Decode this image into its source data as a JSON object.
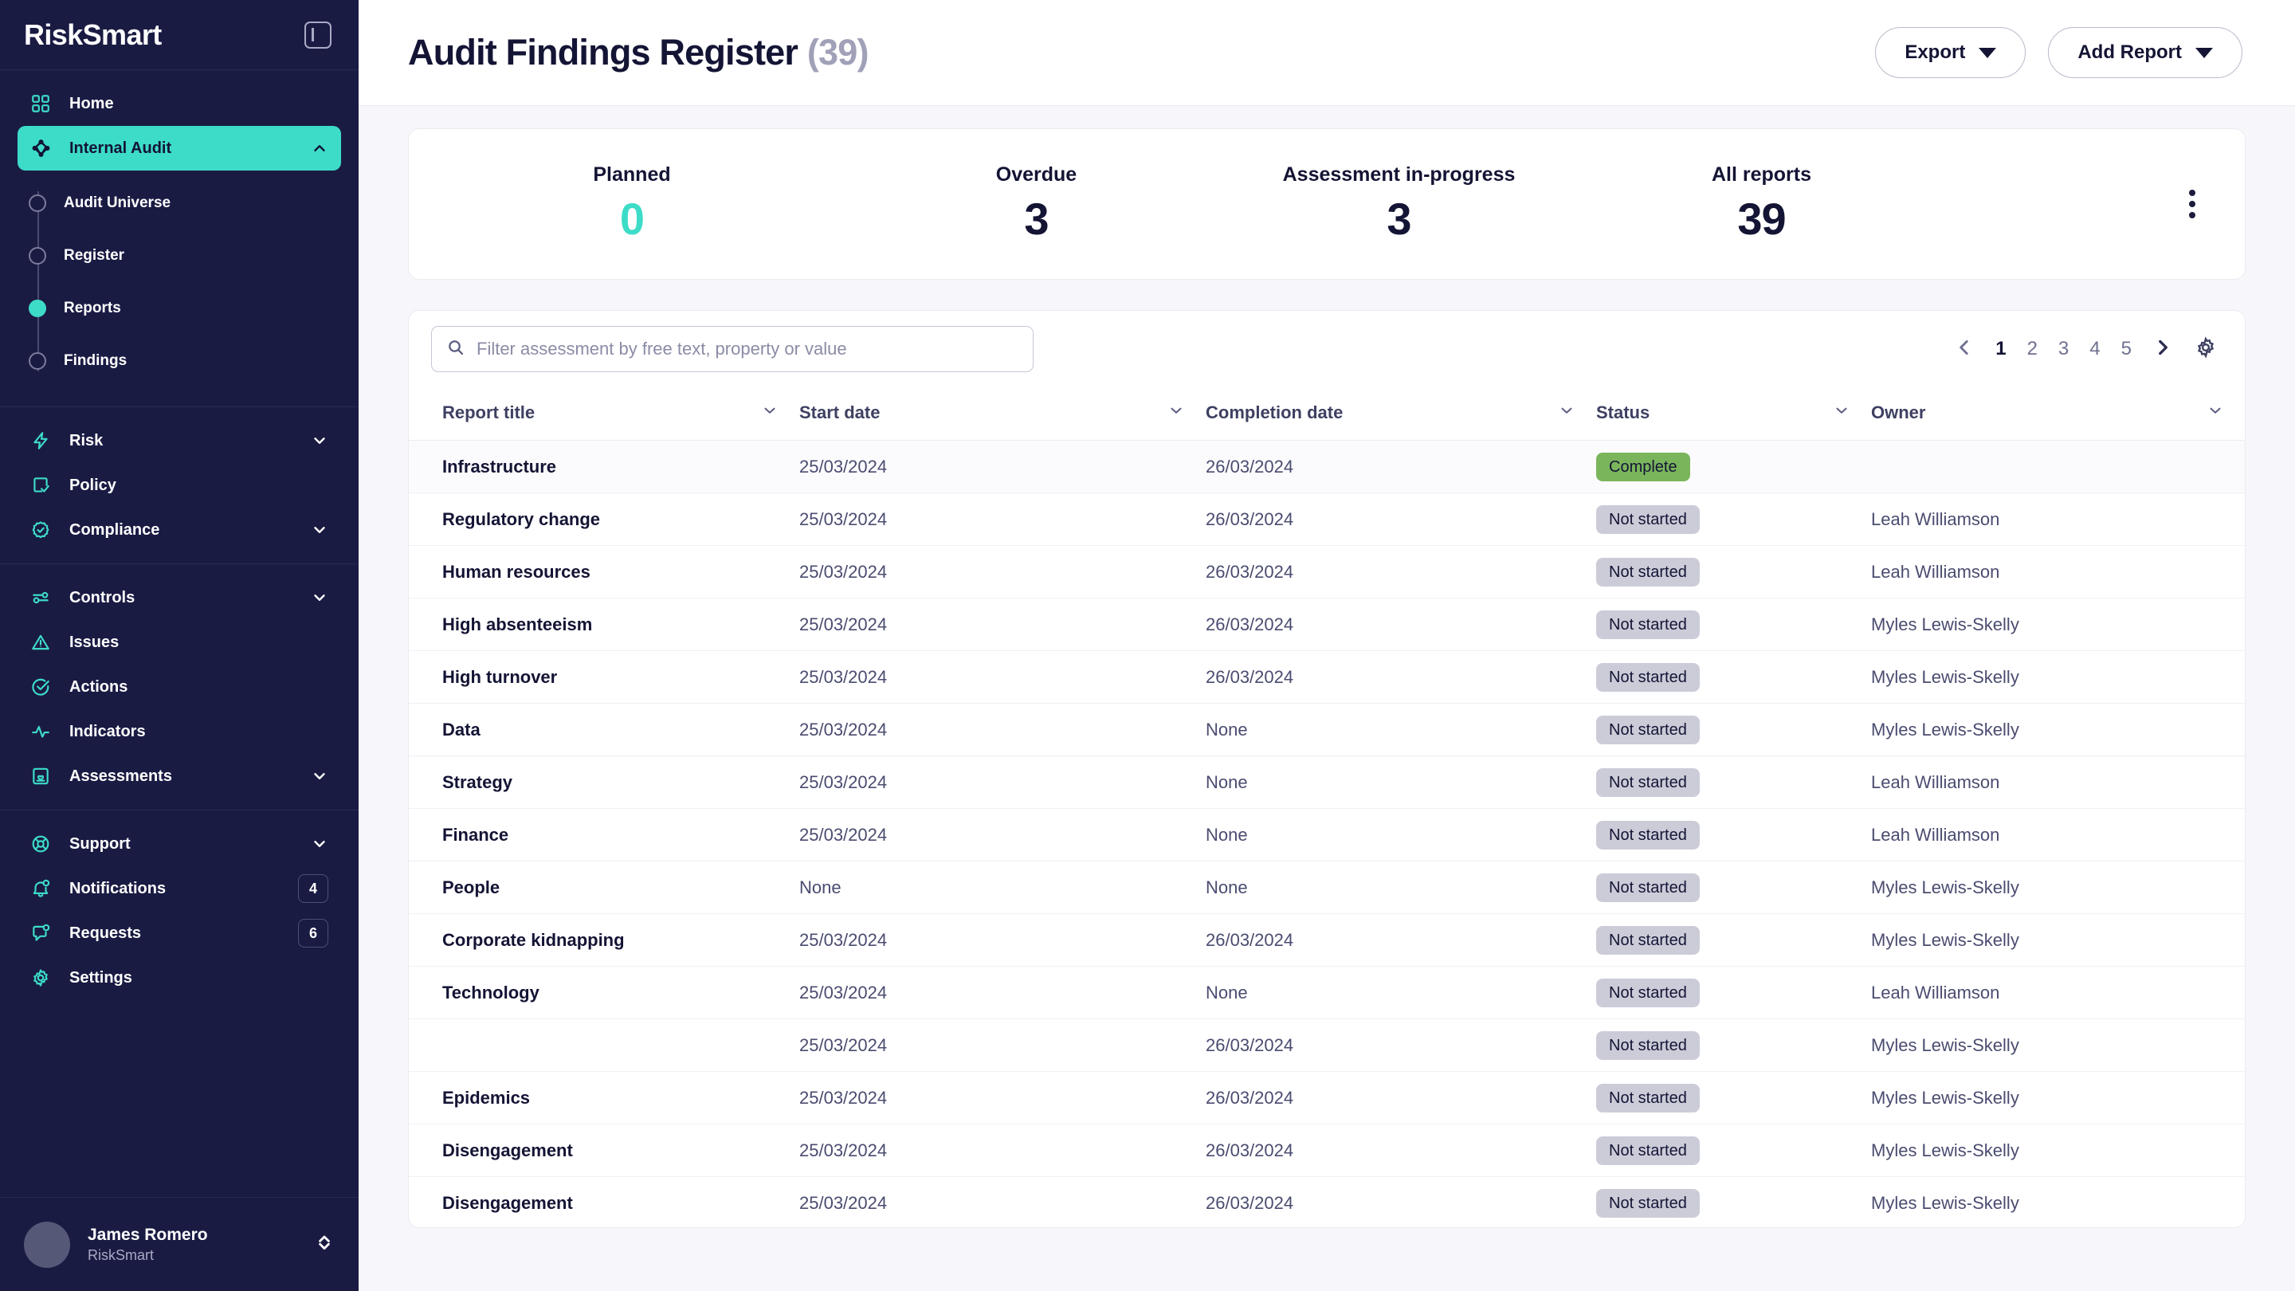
{
  "brand": {
    "name": "RiskSmart",
    "collapse_icon": "panel-collapse-icon"
  },
  "sidebar": {
    "items": [
      {
        "label": "Home",
        "icon": "grid-icon",
        "expandable": false,
        "active": false
      },
      {
        "label": "Internal Audit",
        "icon": "audit-node-icon",
        "expandable": true,
        "expanded": true,
        "active": true
      },
      {
        "label": "Risk",
        "icon": "bolt-icon",
        "expandable": true,
        "active": false
      },
      {
        "label": "Policy",
        "icon": "document-check-icon",
        "expandable": false,
        "active": false
      },
      {
        "label": "Compliance",
        "icon": "badge-check-icon",
        "expandable": true,
        "active": false
      },
      {
        "label": "Controls",
        "icon": "sliders-icon",
        "expandable": true,
        "active": false
      },
      {
        "label": "Issues",
        "icon": "warning-triangle-icon",
        "expandable": false,
        "active": false
      },
      {
        "label": "Actions",
        "icon": "circle-check-icon",
        "expandable": false,
        "active": false
      },
      {
        "label": "Indicators",
        "icon": "pulse-icon",
        "expandable": false,
        "active": false
      },
      {
        "label": "Assessments",
        "icon": "clipboard-heart-icon",
        "expandable": true,
        "active": false
      },
      {
        "label": "Support",
        "icon": "lifebuoy-icon",
        "expandable": true,
        "active": false
      },
      {
        "label": "Notifications",
        "icon": "bell-icon",
        "expandable": false,
        "badge": "4",
        "active": false
      },
      {
        "label": "Requests",
        "icon": "chat-bubble-icon",
        "expandable": false,
        "badge": "6",
        "active": false
      },
      {
        "label": "Settings",
        "icon": "gear-icon",
        "expandable": false,
        "active": false
      }
    ],
    "subitems": [
      {
        "label": "Audit Universe",
        "active": false
      },
      {
        "label": "Register",
        "active": false
      },
      {
        "label": "Reports",
        "active": true
      },
      {
        "label": "Findings",
        "active": false
      }
    ],
    "user": {
      "name": "James Romero",
      "org": "RiskSmart",
      "chevron_icon": "chevron-up-down-icon"
    }
  },
  "header": {
    "title": "Audit Findings Register",
    "count": "(39)",
    "export_label": "Export",
    "add_report_label": "Add Report"
  },
  "stats": {
    "items": [
      {
        "label": "Planned",
        "value": "0",
        "accent": true
      },
      {
        "label": "Overdue",
        "value": "3",
        "accent": false
      },
      {
        "label": "Assessment in-progress",
        "value": "3",
        "accent": false
      },
      {
        "label": "All reports",
        "value": "39",
        "accent": false
      }
    ],
    "menu_icon": "kebab-menu-icon"
  },
  "search": {
    "placeholder": "Filter assessment by free text, property or value",
    "value": "",
    "icon": "search-icon"
  },
  "pagination": {
    "prev_icon": "chevron-left-icon",
    "next_icon": "chevron-right-icon",
    "settings_icon": "gear-icon",
    "pages": [
      "1",
      "2",
      "3",
      "4",
      "5"
    ],
    "current": "1"
  },
  "table": {
    "columns": [
      {
        "label": "Report title",
        "sort_icon": "chevron-down-icon"
      },
      {
        "label": "Start date",
        "sort_icon": "chevron-down-icon"
      },
      {
        "label": "Completion date",
        "sort_icon": "chevron-down-icon"
      },
      {
        "label": "Status",
        "sort_icon": "chevron-down-icon"
      },
      {
        "label": "Owner",
        "sort_icon": "chevron-down-icon"
      }
    ],
    "rows": [
      {
        "title": "Infrastructure",
        "start": "25/03/2024",
        "completion": "26/03/2024",
        "status": "Complete",
        "status_type": "green",
        "owner": "",
        "highlight": true
      },
      {
        "title": "Regulatory change",
        "start": "25/03/2024",
        "completion": "26/03/2024",
        "status": "Not started",
        "status_type": "grey",
        "owner": "Leah Williamson",
        "highlight": false
      },
      {
        "title": "Human resources",
        "start": "25/03/2024",
        "completion": "26/03/2024",
        "status": "Not started",
        "status_type": "grey",
        "owner": "Leah Williamson",
        "highlight": false
      },
      {
        "title": "High absenteeism",
        "start": "25/03/2024",
        "completion": "26/03/2024",
        "status": "Not started",
        "status_type": "grey",
        "owner": "Myles Lewis-Skelly",
        "highlight": false
      },
      {
        "title": "High turnover",
        "start": "25/03/2024",
        "completion": "26/03/2024",
        "status": "Not started",
        "status_type": "grey",
        "owner": "Myles Lewis-Skelly",
        "highlight": false
      },
      {
        "title": "Data",
        "start": "25/03/2024",
        "completion": "None",
        "status": "Not started",
        "status_type": "grey",
        "owner": "Myles Lewis-Skelly",
        "highlight": false
      },
      {
        "title": "Strategy",
        "start": "25/03/2024",
        "completion": "None",
        "status": "Not started",
        "status_type": "grey",
        "owner": "Leah Williamson",
        "highlight": false
      },
      {
        "title": "Finance",
        "start": "25/03/2024",
        "completion": "None",
        "status": "Not started",
        "status_type": "grey",
        "owner": "Leah Williamson",
        "highlight": false
      },
      {
        "title": "People",
        "start": "None",
        "completion": "None",
        "status": "Not started",
        "status_type": "grey",
        "owner": "Myles Lewis-Skelly",
        "highlight": false
      },
      {
        "title": "Corporate kidnapping",
        "start": "25/03/2024",
        "completion": "26/03/2024",
        "status": "Not started",
        "status_type": "grey",
        "owner": "Myles Lewis-Skelly",
        "highlight": false
      },
      {
        "title": "Technology",
        "start": "25/03/2024",
        "completion": "None",
        "status": "Not started",
        "status_type": "grey",
        "owner": "Leah Williamson",
        "highlight": false
      },
      {
        "title": "",
        "start": "25/03/2024",
        "completion": "26/03/2024",
        "status": "Not started",
        "status_type": "grey",
        "owner": "Myles Lewis-Skelly",
        "highlight": false
      },
      {
        "title": "Epidemics",
        "start": "25/03/2024",
        "completion": "26/03/2024",
        "status": "Not started",
        "status_type": "grey",
        "owner": "Myles Lewis-Skelly",
        "highlight": false
      },
      {
        "title": "Disengagement",
        "start": "25/03/2024",
        "completion": "26/03/2024",
        "status": "Not started",
        "status_type": "grey",
        "owner": "Myles Lewis-Skelly",
        "highlight": false
      },
      {
        "title": "Disengagement",
        "start": "25/03/2024",
        "completion": "26/03/2024",
        "status": "Not started",
        "status_type": "grey",
        "owner": "Myles Lewis-Skelly",
        "highlight": false
      }
    ]
  },
  "colors": {
    "sidebar_bg": "#1A1B43",
    "accent_teal": "#3DDCC8",
    "page_bg": "#F7F7FB",
    "status_complete": "#7AB55C",
    "status_not_started": "#CBCCD8",
    "text_dark": "#141435"
  }
}
